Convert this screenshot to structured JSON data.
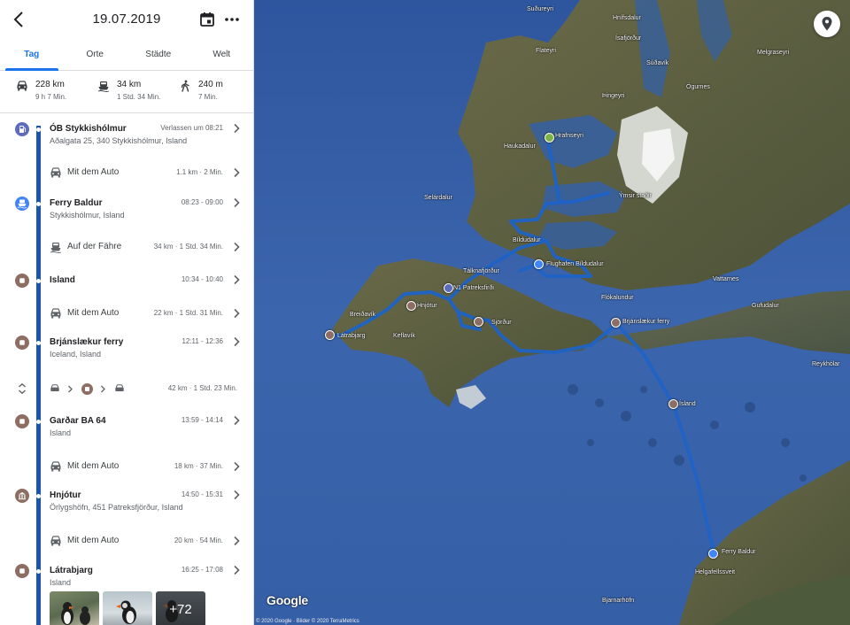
{
  "header": {
    "date": "19.07.2019"
  },
  "tabs": [
    {
      "label": "Tag"
    },
    {
      "label": "Orte"
    },
    {
      "label": "Städte"
    },
    {
      "label": "Welt"
    }
  ],
  "summary": {
    "car": {
      "distance": "228 km",
      "duration": "9 h 7 Min."
    },
    "ferry": {
      "distance": "34 km",
      "duration": "1 Std. 34 Min."
    },
    "walk": {
      "distance": "240 m",
      "duration": "7 Min."
    }
  },
  "timeline": {
    "stops": [
      {
        "name": "ÓB Stykkishólmur",
        "time": "Verlassen um 08:21",
        "address": "Aðalgata 25, 340 Stykkishólmur, Island",
        "icon": "gas-station-icon",
        "color": "#5c6bc0"
      },
      {
        "name": "Ferry Baldur",
        "time": "08:23 - 09:00",
        "address": "Stykkishólmur, Island",
        "icon": "ferry-icon",
        "color": "#4285f4"
      },
      {
        "name": "Island",
        "time": "10:34 - 10:40",
        "address": "",
        "icon": "place-icon",
        "color": "#8d6e63"
      },
      {
        "name": "Brjánslækur ferry",
        "time": "12:11 - 12:36",
        "address": "Iceland, Island",
        "icon": "place-icon",
        "color": "#8d6e63"
      },
      {
        "name": "Garðar BA 64",
        "time": "13:59 - 14:14",
        "address": "Island",
        "icon": "place-icon",
        "color": "#8d6e63"
      },
      {
        "name": "Hnjótur",
        "time": "14:50 - 15:31",
        "address": "Örlygshöfn, 451 Patreksfjörður, Island",
        "icon": "museum-icon",
        "color": "#8d6e63"
      },
      {
        "name": "Látrabjarg",
        "time": "16:25 - 17:08",
        "address": "Island",
        "icon": "place-icon",
        "color": "#8d6e63"
      }
    ],
    "moves": [
      {
        "label": "Mit dem Auto",
        "detail": "1.1 km · 2 Min."
      },
      {
        "label": "Auf der Fähre",
        "detail": "34 km · 1 Std. 34 Min."
      },
      {
        "label": "Mit dem Auto",
        "detail": "22 km · 1 Std. 31 Min."
      },
      {
        "label": "",
        "detail": "42 km · 1 Std. 23 Min."
      },
      {
        "label": "Mit dem Auto",
        "detail": "18 km · 37 Min."
      },
      {
        "label": "Mit dem Auto",
        "detail": "20 km · 54 Min."
      }
    ],
    "photos_more": "+72"
  },
  "map": {
    "attribution": "© 2020 Google · Bilder © 2020 TerraMetrics",
    "logo": "Google",
    "labels": [
      "Suðureyri",
      "Hnífsdalur",
      "Ísafjörður",
      "Flateyri",
      "Súðavík",
      "Ögurnes",
      "Melgraseyri",
      "Þingeyri",
      "Haukadalur",
      "Hrafnseyri",
      "Ýmsir staðir",
      "Selárdalur",
      "Bíldudalur",
      "Tálknafjörður",
      "Flughafen Bíldudalur",
      "N1 Patreksfirði",
      "Hnjótur",
      "Breiðavík",
      "Látrabjarg",
      "Keflavík",
      "Sjörður",
      "Flókalundur",
      "Brjánslækur ferry",
      "Vattarnes",
      "Gufudalur",
      "Reykhólar",
      "Ísland",
      "Ferry Baldur",
      "Helgafellssveit",
      "Bjarnarhöfn"
    ]
  }
}
